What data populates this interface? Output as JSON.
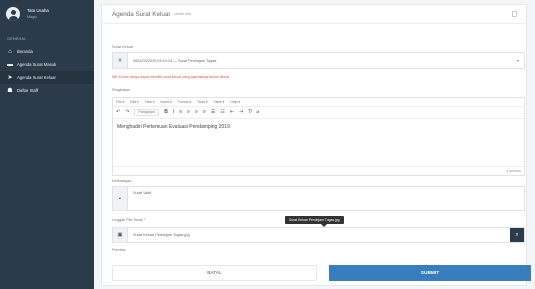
{
  "sidebar": {
    "user": {
      "name": "Tata Usaha",
      "role": "Magic"
    },
    "menu_heading": "GENERAL",
    "items": [
      {
        "label": "Beranda",
        "icon": "home-icon"
      },
      {
        "label": "Agenda Surat Masuk",
        "icon": "inbox-icon"
      },
      {
        "label": "Agenda Surat Keluar",
        "icon": "send-icon"
      },
      {
        "label": "Daftar Staff",
        "icon": "users-icon"
      }
    ]
  },
  "card": {
    "title": "Agenda Surat Keluar",
    "subtitle": "create new"
  },
  "form": {
    "surat_keluar_label": "Surat Keluar",
    "surat_keluar_value": "0002/03/2019 03:10:14 — Surat Peminjam Tugas",
    "warning": "NB: Kolom hanya dapat memilih surat keluar yang agendanya belum dibuat",
    "ringkasan_label": "Ringkasan",
    "editor_menu": [
      "File ▾",
      "Edit ▾",
      "View ▾",
      "Insert ▾",
      "Format ▾",
      "Tools ▾",
      "Table ▾",
      "Help ▾"
    ],
    "paragraph_label": "Paragraph",
    "editor_content": "Menghadiri Pertemuan Evaluasi Pendamping 2019",
    "word_count": "6 WORDS",
    "keterangan_label": "Keterangan",
    "keterangan_value": "Surat Valid",
    "file_label": "Unggah File Surat *",
    "file_value": "Surat Keluar Peminjam Tugas.jpg",
    "tooltip": "Surat Keluar Peminjam Tugas.jpg",
    "preview_label": "Preview",
    "cancel_label": "BATAL",
    "submit_label": "SUBMIT"
  },
  "colors": {
    "sidebar_bg": "#2c3b4b",
    "submit_bg": "#3a7dbd",
    "warning": "#d9534f"
  }
}
